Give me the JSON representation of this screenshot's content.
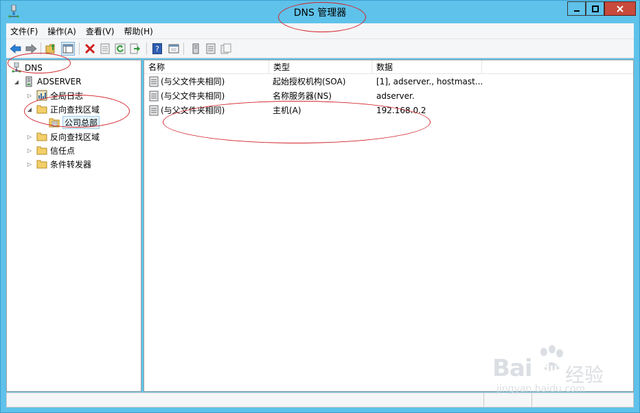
{
  "window": {
    "title": "DNS 管理器"
  },
  "menu": [
    {
      "label": "文件(F)"
    },
    {
      "label": "操作(A)"
    },
    {
      "label": "查看(V)"
    },
    {
      "label": "帮助(H)"
    }
  ],
  "toolbar": {
    "icons": [
      "back-icon",
      "forward-icon",
      "up-folder-icon",
      "show-tree-icon",
      "delete-icon",
      "properties-icon",
      "refresh-icon",
      "export-icon",
      "help-icon",
      "console-icon",
      "server-icon",
      "list-icon",
      "copy-icon"
    ]
  },
  "tree": {
    "root": "DNS",
    "server": "ADSERVER",
    "items": [
      {
        "label": "全局日志"
      },
      {
        "label": "正向查找区域"
      },
      {
        "label": "公司总部"
      },
      {
        "label": "反向查找区域"
      },
      {
        "label": "信任点"
      },
      {
        "label": "条件转发器"
      }
    ]
  },
  "list": {
    "columns": [
      "名称",
      "类型",
      "数据"
    ],
    "rows": [
      {
        "name": "(与父文件夹相同)",
        "type": "起始授权机构(SOA)",
        "data": "[1], adserver., hostmast..."
      },
      {
        "name": "(与父文件夹相同)",
        "type": "名称服务器(NS)",
        "data": "adserver."
      },
      {
        "name": "(与父文件夹相同)",
        "type": "主机(A)",
        "data": "192.168.0.2"
      }
    ]
  },
  "watermark": {
    "brand": "Bai",
    "du": "du",
    "cn": "经验",
    "url": "jingyan.baidu.com"
  },
  "colors": {
    "titlebar": "#5fc2ea",
    "close": "#c74a3c",
    "annotation": "#d2232a"
  }
}
